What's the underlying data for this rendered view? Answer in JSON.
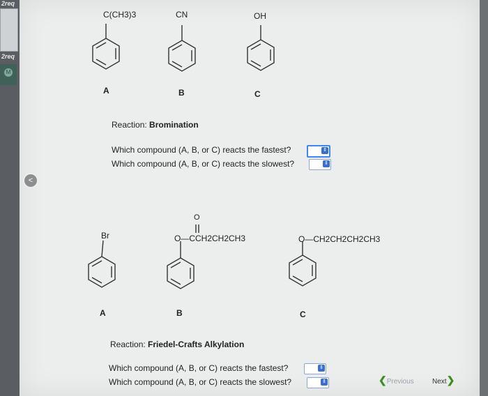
{
  "rail": {
    "top_label": "2req",
    "mid_label": "2req",
    "badge_icon": "m-badge-icon",
    "back_icon": "circle-back-icon"
  },
  "top_set": {
    "molecules": [
      {
        "substituent": "C(CH3)3",
        "letter": "A"
      },
      {
        "substituent": "CN",
        "letter": "B"
      },
      {
        "substituent": "OH",
        "letter": "C"
      }
    ],
    "reaction_prefix": "Reaction: ",
    "reaction_name": "Bromination",
    "q_fastest": "Which compound (A, B, or C) reacts the fastest?",
    "q_slowest": "Which compound (A, B, or C) reacts the slowest?"
  },
  "bottom_set": {
    "molecules": [
      {
        "substituent": "Br",
        "letter": "A"
      },
      {
        "substituent": "O—CCH2CH2CH3",
        "carbonyl_o": "O",
        "letter": "B"
      },
      {
        "substituent": "O—CH2CH2CH2CH3",
        "letter": "C"
      }
    ],
    "reaction_prefix": "Reaction: ",
    "reaction_name": "Friedel-Crafts Alkylation",
    "q_fastest": "Which compound (A, B, or C) reacts the fastest?",
    "q_slowest": "Which compound (A, B, or C) reacts the slowest?"
  },
  "nav": {
    "previous": "Previous",
    "next": "Next"
  },
  "colors": {
    "select_border": "#8aa6d6",
    "select_focus": "#3f86f5",
    "select_arrow": "#3a6fd0",
    "nav_arrow": "#3a8f1f"
  }
}
